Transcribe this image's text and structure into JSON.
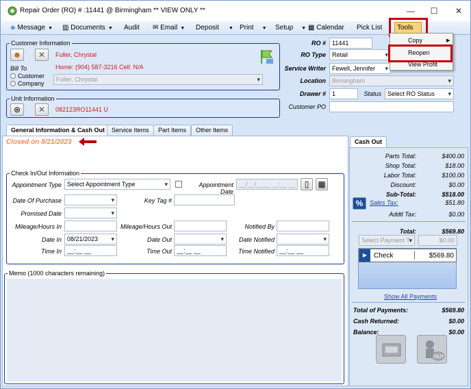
{
  "window": {
    "title": "Repair Order (RO) # :11441 @ Birmingham ** VIEW ONLY **"
  },
  "menu": {
    "message": "Message",
    "documents": "Documents",
    "audit": "Audit",
    "email": "Email",
    "deposit": "Deposit",
    "print": "Print",
    "setup": "Setup",
    "calendar": "Calendar",
    "pick_list": "Pick List",
    "tools": "Tools"
  },
  "tools_menu": {
    "copy": "Copy",
    "reopen": "Reopen",
    "view_profit": "View Profit"
  },
  "customer": {
    "group_label": "Customer Information",
    "name": "Fuller, Chrystal",
    "phones": "Home: (904) 587-3216 Cell: N/A",
    "bill_to_label": "Bill To",
    "bill_customer": "Customer",
    "bill_company": "Company",
    "bill_select": "Fuller, Chrystal"
  },
  "unit": {
    "group_label": "Unit Information",
    "number": "082123RO11441 U"
  },
  "ro": {
    "ro_num_label": "RO #",
    "ro_num": "11441",
    "ro_type_label": "RO Type",
    "ro_type": "Retail",
    "writer_label": "Service Writer",
    "writer": "Fewell, Jennifer",
    "location_label": "Location",
    "location": "Birmingham",
    "drawer_label": "Drawer #",
    "drawer": "1",
    "status_label": "Status",
    "status": "Select RO Status",
    "po_label": "Customer PO",
    "po": ""
  },
  "tabs": [
    "General Information & Cash Out",
    "Service Items",
    "Part Items",
    "Other Items"
  ],
  "closed_on": "Closed on 8/21/2023",
  "checkin": {
    "group_label": "Check In/Out Information",
    "appt_type_label": "Appointment Type",
    "appt_type": "Select Appointment Type",
    "appt_date_label": "Appointment Date",
    "appt_date": "__/__/____ __:__ __",
    "purchase_label": "Date Of Purchase",
    "keytag_label": "Key Tag #",
    "promised_label": "Promised Date",
    "mileage_in_label": "Mileage/Hours In",
    "mileage_out_label": "Mileage/Hours Out",
    "notified_by_label": "Notified By",
    "date_in_label": "Date In",
    "date_in": "08/21/2023",
    "date_out_label": "Date Out",
    "date_notified_label": "Date Notified",
    "time_in_label": "Time In",
    "time_in": "__:__ __",
    "time_out_label": "Time Out",
    "time_out": "__:__ __",
    "time_notified_label": "Time Notified",
    "time_notified": "__:__ __"
  },
  "memo": {
    "label": "Memo (1000 characters remaining)"
  },
  "cashout": {
    "tab": "Cash Out",
    "parts_label": "Parts Total:",
    "parts": "$400.00",
    "shop_label": "Shop Total:",
    "shop": "$18.00",
    "labor_label": "Labor Total:",
    "labor": "$100.00",
    "discount_label": "Discount:",
    "discount": "$0.00",
    "subtotal_label": "Sub-Total:",
    "subtotal": "$518.00",
    "salestax_label": "Sales Tax:",
    "salestax": "$51.80",
    "addtl_label": "Addtl Tax:",
    "addtl": "$0.00",
    "total_label": "Total:",
    "total": "$569.80",
    "payment_select": "Select Payment T",
    "payment_amount": "$0.00",
    "payment_method": "Check",
    "payment_value": "$569.80",
    "show_all": "Show All Payments",
    "total_payments_label": "Total of Payments:",
    "total_payments": "$569.80",
    "cash_returned_label": "Cash Returned:",
    "cash_returned": "$0.00",
    "balance_label": "Balance:",
    "balance": "$0.00"
  },
  "colors": {
    "highlight": "#c00000",
    "accent_red": "#d01818",
    "closed_orange": "#f08a5d"
  }
}
